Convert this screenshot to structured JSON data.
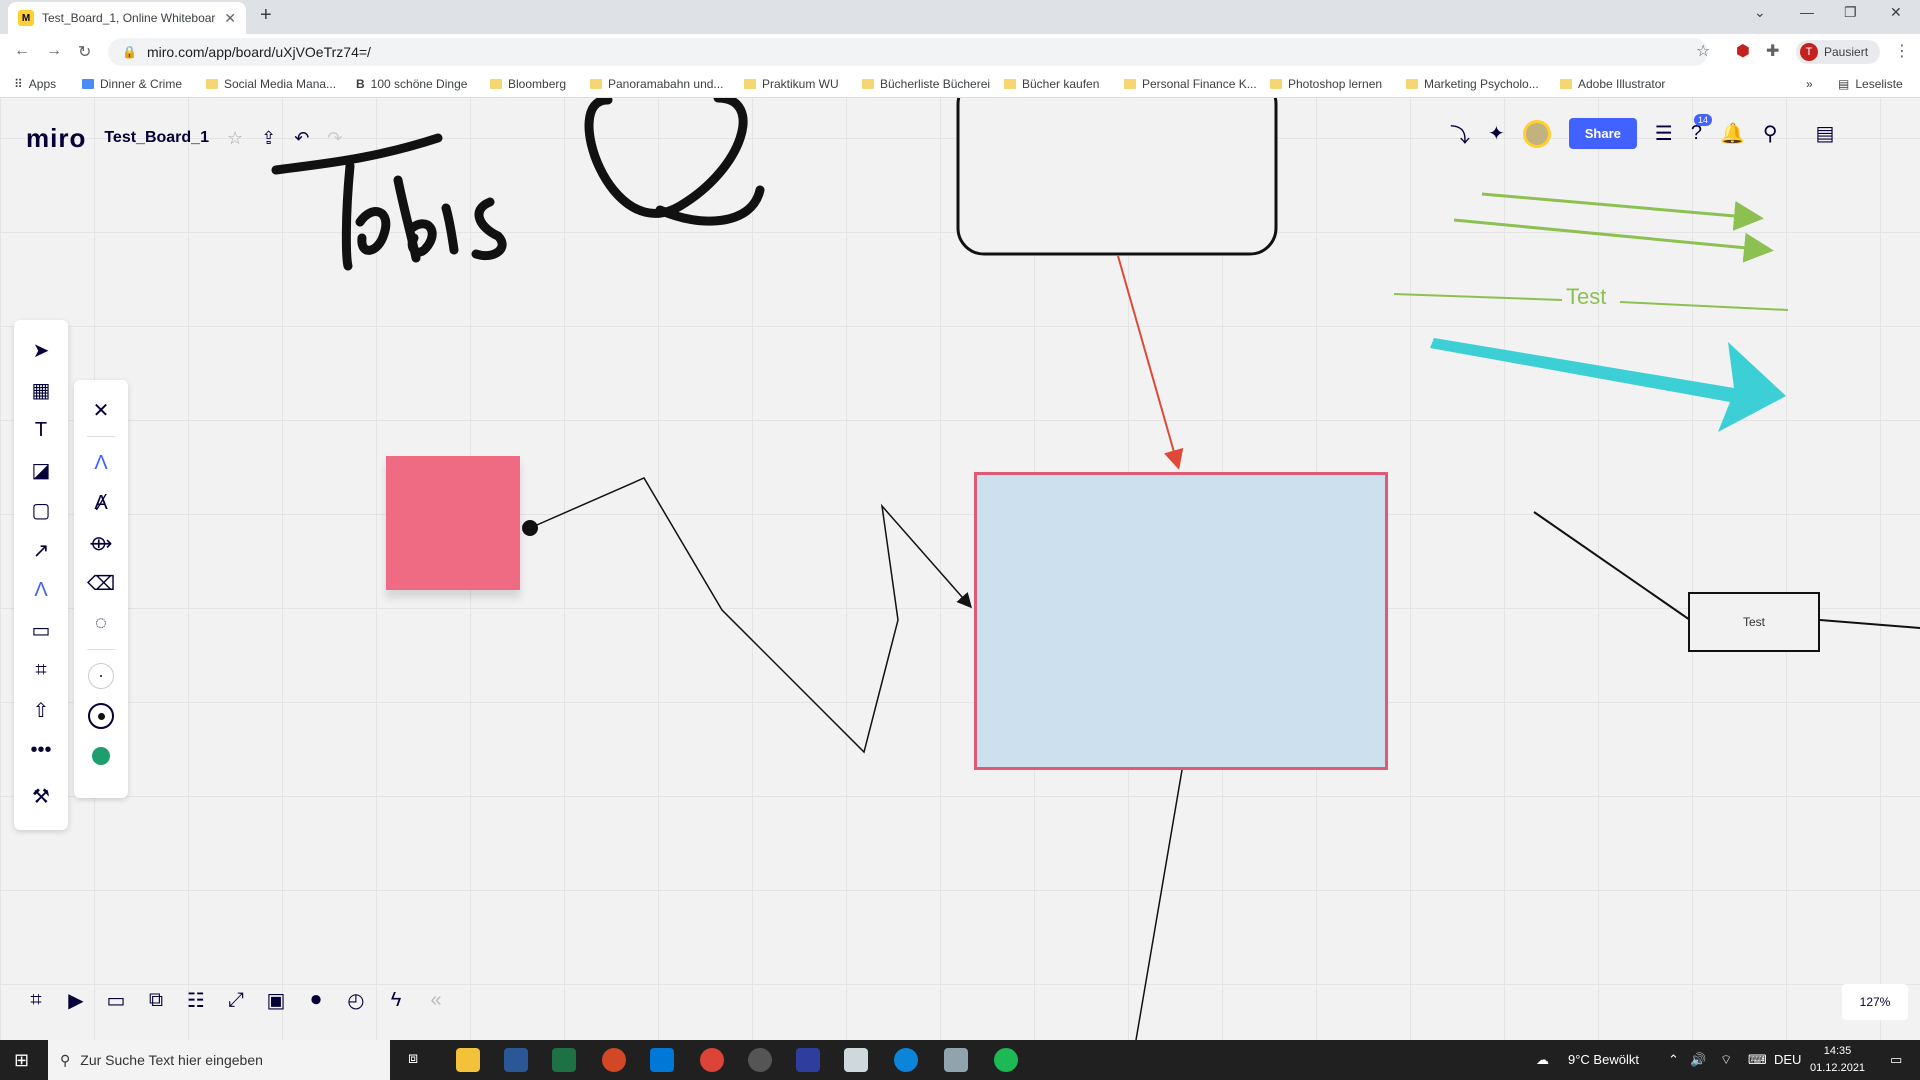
{
  "browser": {
    "tab_title": "Test_Board_1, Online Whiteboard",
    "url": "miro.com/app/board/uXjVOeTrz74=/",
    "profile_initial": "T",
    "profile_status": "Pausiert",
    "reading_list": "Leseliste",
    "bookmarks": [
      "Apps",
      "Dinner & Crime",
      "Social Media Mana...",
      "100 schöne Dinge",
      "Bloomberg",
      "Panoramabahn und...",
      "Praktikum WU",
      "Bücherliste Bücherei",
      "Bücher kaufen",
      "Personal Finance K...",
      "Photoshop lernen",
      "Marketing Psycholo...",
      "Adobe Illustrator"
    ]
  },
  "app": {
    "logo": "miro",
    "board_name": "Test_Board_1",
    "share_label": "Share",
    "help_badge": "14",
    "zoom": "127%"
  },
  "canvas": {
    "test_arrow_label": "Test",
    "test_box_label": "Test",
    "handwriting": "Tobis"
  },
  "taskbar": {
    "search_placeholder": "Zur Suche Text hier eingeben",
    "weather": "9°C  Bewölkt",
    "language": "DEU",
    "time": "14:35",
    "date": "01.12.2021"
  },
  "colors": {
    "miro_yellow": "#ffd02f",
    "share_blue": "#4262ff",
    "sticky_pink": "#ef6b83",
    "rect_fill": "#cce0ee",
    "rect_border": "#e05a75",
    "red_arrow": "#e0483a",
    "green_lines": "#8cc152",
    "cyan_arrow": "#3dcfd6",
    "pen_green": "#1e9e6e"
  }
}
